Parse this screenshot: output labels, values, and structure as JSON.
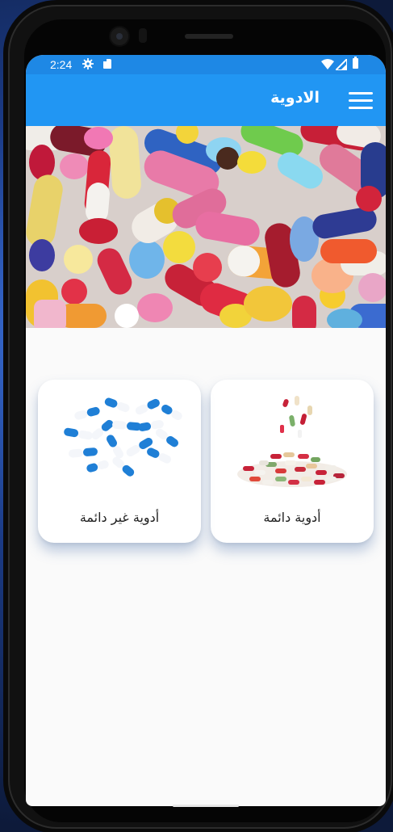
{
  "status_bar": {
    "time": "2:24",
    "icons": [
      "gear-icon",
      "sd-card-icon",
      "wifi-icon",
      "signal-icon",
      "battery-icon"
    ]
  },
  "app_bar": {
    "title": "الادوية",
    "menu_icon": "hamburger-menu-icon",
    "color": "#2196f3"
  },
  "banner": {
    "image": "colorful-pills-banner"
  },
  "categories": [
    {
      "label": "أدوية دائمة",
      "image": "pile-of-mixed-pills"
    },
    {
      "label": "أدوية غير دائمة",
      "image": "blue-white-capsules"
    }
  ]
}
